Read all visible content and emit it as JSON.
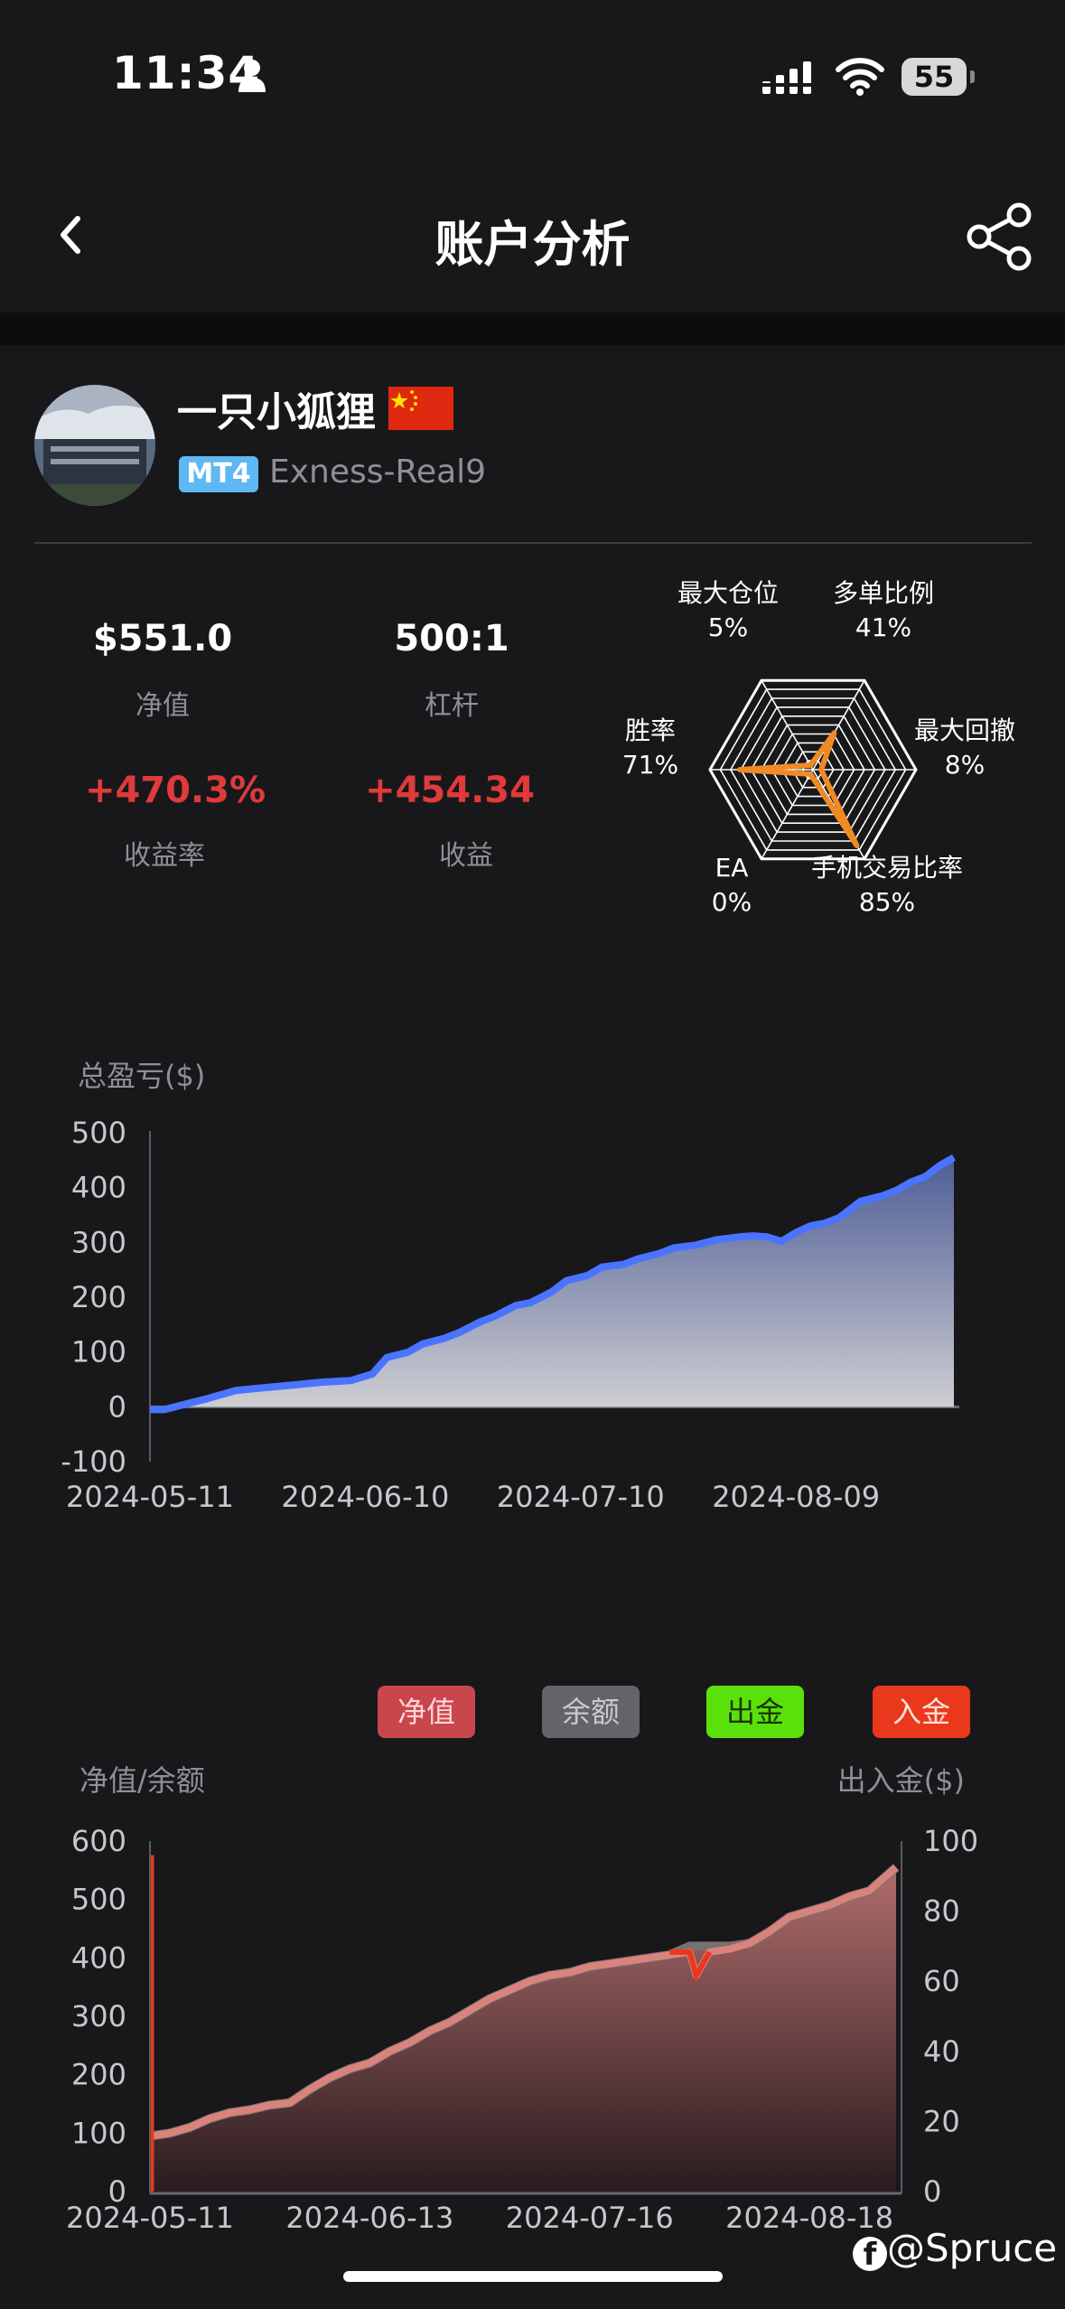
{
  "status_bar": {
    "time": "11:34",
    "battery": "55"
  },
  "nav": {
    "title": "账户分析"
  },
  "profile": {
    "username": "一只小狐狸",
    "platform": "MT4",
    "server": "Exness-Real9"
  },
  "stats": {
    "equity_value": "$551.0",
    "equity_label": "净值",
    "leverage_value": "500:1",
    "leverage_label": "杠杆",
    "return_rate_value": "+470.3%",
    "return_rate_label": "收益率",
    "profit_value": "+454.34",
    "profit_label": "收益"
  },
  "radar": {
    "axes": [
      {
        "name": "最大仓位",
        "value": "5%",
        "fraction": 0.05
      },
      {
        "name": "多单比例",
        "value": "41%",
        "fraction": 0.41
      },
      {
        "name": "最大回撤",
        "value": "8%",
        "fraction": 0.08
      },
      {
        "name": "手机交易比率",
        "value": "85%",
        "fraction": 0.85
      },
      {
        "name": "EA",
        "value": "0%",
        "fraction": 0.0
      },
      {
        "name": "胜率",
        "value": "71%",
        "fraction": 0.71
      }
    ],
    "colors": {
      "line": "#f08a24",
      "grid": "#ffffff"
    }
  },
  "pnl_chart": {
    "ylabel": "总盈亏($)",
    "y_ticks": [
      "500",
      "400",
      "300",
      "200",
      "100",
      "0",
      "-100"
    ],
    "x_ticks": [
      "2024-05-11",
      "2024-06-10",
      "2024-07-10",
      "2024-08-09"
    ]
  },
  "equity_chart": {
    "legend": [
      "净值",
      "余额",
      "出金",
      "入金"
    ],
    "left_label": "净值/余额",
    "right_label": "出入金($)",
    "left_ticks": [
      "600",
      "500",
      "400",
      "300",
      "200",
      "100",
      "0"
    ],
    "right_ticks": [
      "100",
      "80",
      "60",
      "40",
      "20",
      "0"
    ],
    "x_ticks": [
      "2024-05-11",
      "2024-06-13",
      "2024-07-16",
      "2024-08-18"
    ]
  },
  "chart_data": [
    {
      "type": "area",
      "title": "",
      "ylabel": "总盈亏($)",
      "xlabel": "",
      "ylim": [
        -100,
        500
      ],
      "x_ticks": [
        "2024-05-11",
        "2024-06-10",
        "2024-07-10",
        "2024-08-09"
      ],
      "x_range_days": [
        0,
        112
      ],
      "series": [
        {
          "name": "总盈亏",
          "x_days": [
            0,
            2,
            5,
            8,
            12,
            16,
            20,
            24,
            28,
            31,
            33,
            36,
            38,
            41,
            43,
            46,
            48,
            51,
            53,
            56,
            58,
            61,
            63,
            66,
            68,
            71,
            73,
            76,
            79,
            82,
            84,
            86,
            88,
            90,
            92,
            94,
            96,
            99,
            102,
            104,
            106,
            108,
            110,
            112
          ],
          "y": [
            -5,
            -5,
            5,
            15,
            30,
            35,
            40,
            45,
            48,
            60,
            90,
            100,
            115,
            125,
            135,
            155,
            165,
            185,
            190,
            210,
            230,
            240,
            255,
            260,
            270,
            280,
            290,
            295,
            305,
            310,
            312,
            310,
            302,
            318,
            330,
            335,
            345,
            375,
            385,
            395,
            410,
            420,
            440,
            455
          ]
        }
      ]
    },
    {
      "type": "area",
      "title": "",
      "ylabel": "净值/余额",
      "y2label": "出入金($)",
      "ylim": [
        0,
        600
      ],
      "y2lim": [
        0,
        100
      ],
      "x_ticks": [
        "2024-05-11",
        "2024-06-13",
        "2024-07-16",
        "2024-08-18"
      ],
      "x_range_days": [
        0,
        112
      ],
      "series": [
        {
          "name": "净值",
          "x_days": [
            0,
            3,
            6,
            9,
            12,
            15,
            18,
            21,
            24,
            27,
            30,
            33,
            36,
            39,
            42,
            45,
            48,
            51,
            54,
            57,
            60,
            63,
            66,
            69,
            72,
            75,
            78,
            81,
            82,
            84,
            87,
            90,
            93,
            96,
            99,
            102,
            105,
            108,
            110,
            112
          ],
          "y": [
            95,
            100,
            110,
            125,
            135,
            140,
            148,
            152,
            175,
            195,
            210,
            220,
            240,
            255,
            275,
            290,
            310,
            330,
            345,
            360,
            370,
            375,
            385,
            390,
            395,
            400,
            405,
            410,
            370,
            410,
            415,
            425,
            445,
            470,
            480,
            490,
            505,
            515,
            535,
            555
          ]
        },
        {
          "name": "余额",
          "x_days": [
            0,
            3,
            6,
            9,
            12,
            15,
            18,
            21,
            24,
            27,
            30,
            33,
            36,
            39,
            42,
            45,
            48,
            51,
            54,
            57,
            60,
            63,
            66,
            69,
            72,
            75,
            78,
            81,
            84,
            87,
            90,
            93,
            96,
            99,
            102,
            105,
            108,
            110,
            112
          ],
          "y": [
            95,
            100,
            110,
            125,
            135,
            140,
            148,
            152,
            175,
            195,
            210,
            220,
            240,
            255,
            275,
            290,
            310,
            330,
            345,
            360,
            370,
            375,
            385,
            390,
            395,
            400,
            405,
            420,
            420,
            420,
            425,
            445,
            470,
            480,
            490,
            505,
            515,
            535,
            555
          ]
        },
        {
          "name": "入金",
          "axis": "right",
          "x_days": [
            0
          ],
          "y": [
            96
          ]
        },
        {
          "name": "出金",
          "axis": "right",
          "x_days": [],
          "y": []
        }
      ]
    }
  ]
}
